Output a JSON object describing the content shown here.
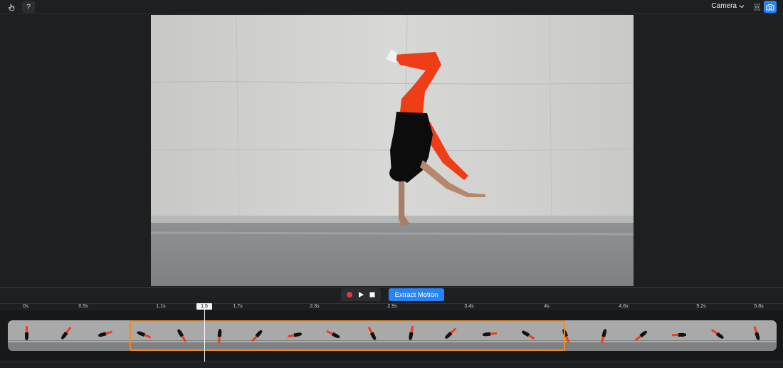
{
  "toolbar": {
    "left_icon": "hand-touch-icon",
    "help_label": "?",
    "view_label": "Camera",
    "compare_icon": "split-compare-icon",
    "camera_icon": "camera-icon",
    "accent": "#2684f6"
  },
  "transport": {
    "record_icon": "record-icon",
    "play_icon": "play-icon",
    "stop_icon": "stop-icon",
    "record_color": "#e5383b",
    "extract_label": "Extract Motion"
  },
  "timeline": {
    "ticks": [
      "0s",
      "0.5s",
      "1.1s",
      "1.7s",
      "2.3s",
      "2.9s",
      "3.4s",
      "4s",
      "4.6s",
      "5.2s",
      "5.8s"
    ],
    "playhead": "1.5",
    "selection_color": "#f08a26",
    "thumbnail_count": 20
  }
}
